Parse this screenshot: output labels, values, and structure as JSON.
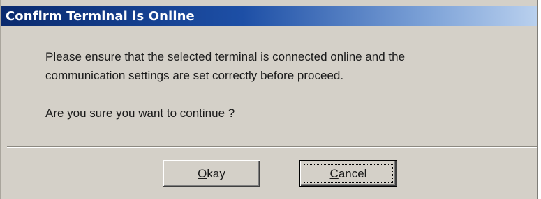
{
  "dialog": {
    "title": "Confirm Terminal is Online",
    "message_line1": "Please ensure that the selected terminal is connected online and the",
    "message_line2": "communication settings are set correctly before proceed.",
    "question": "Are you sure you want to continue ?",
    "buttons": {
      "okay": {
        "mnemonic": "O",
        "rest": "kay"
      },
      "cancel": {
        "mnemonic": "C",
        "rest": "ancel"
      }
    }
  },
  "colors": {
    "title_bar_start": "#0a2a6e",
    "title_bar_end": "#b9d0ee",
    "dialog_face": "#d4d0c8",
    "title_text": "#ffffff"
  }
}
